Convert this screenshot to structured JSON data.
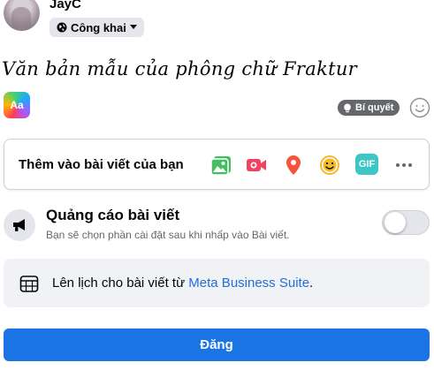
{
  "user": {
    "name": "JayC"
  },
  "privacy": {
    "label": "Công khai",
    "icon": "globe-icon"
  },
  "composer": {
    "text": "Văn bản mẫu của phông chữ Fraktur",
    "font_button_label": "Aa"
  },
  "tips": {
    "label": "Bí quyết",
    "icon": "lightbulb-icon"
  },
  "add_to_post": {
    "label": "Thêm vào bài viết của bạn",
    "icons": [
      "photo-video-icon",
      "live-video-icon",
      "check-in-icon",
      "feeling-icon",
      "gif-icon",
      "more-icon"
    ],
    "gif_label": "GIF"
  },
  "promotion": {
    "title": "Quảng cáo bài viết",
    "subtitle": "Bạn sẽ chọn phần cài đặt sau khi nhấp vào Bài viết.",
    "enabled": false
  },
  "schedule": {
    "prefix": "Lên lịch cho bài viết từ ",
    "link": "Meta Business Suite",
    "suffix": "."
  },
  "submit": {
    "label": "Đăng"
  },
  "colors": {
    "accent": "#1b74e4",
    "link": "#216fdb",
    "muted": "#65676b",
    "surface": "#f0f2f5"
  }
}
